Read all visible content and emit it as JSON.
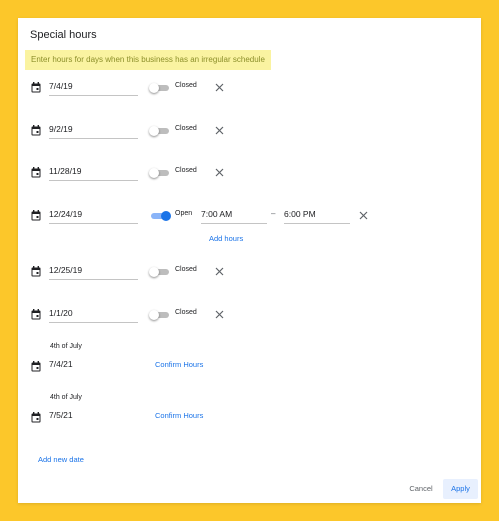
{
  "dialog": {
    "title": "Special hours",
    "hint": "Enter hours for days when this business has an irregular schedule"
  },
  "rows": [
    {
      "date": "7/4/19",
      "status": "Closed"
    },
    {
      "date": "9/2/19",
      "status": "Closed"
    },
    {
      "date": "11/28/19",
      "status": "Closed"
    },
    {
      "date": "12/24/19",
      "status": "Open",
      "open_time": "7:00 AM",
      "separator": "–",
      "close_time": "6:00 PM",
      "add_hours_label": "Add hours"
    },
    {
      "date": "12/25/19",
      "status": "Closed"
    },
    {
      "date": "1/1/20",
      "status": "Closed"
    }
  ],
  "suggestions": [
    {
      "holiday": "4th of July",
      "date": "7/4/21",
      "action": "Confirm Hours"
    },
    {
      "holiday": "4th of July",
      "date": "7/5/21",
      "action": "Confirm Hours"
    }
  ],
  "add_new_date_label": "Add new date",
  "footer": {
    "cancel_label": "Cancel",
    "apply_label": "Apply"
  },
  "icons": {
    "calendar": "calendar-icon",
    "close": "close-icon",
    "toggle": "toggle-switch"
  },
  "colors": {
    "background": "#fcc72a",
    "accent": "#1a73e8",
    "hint_background": "#faf3a1",
    "hint_text": "#8c8f2a"
  }
}
